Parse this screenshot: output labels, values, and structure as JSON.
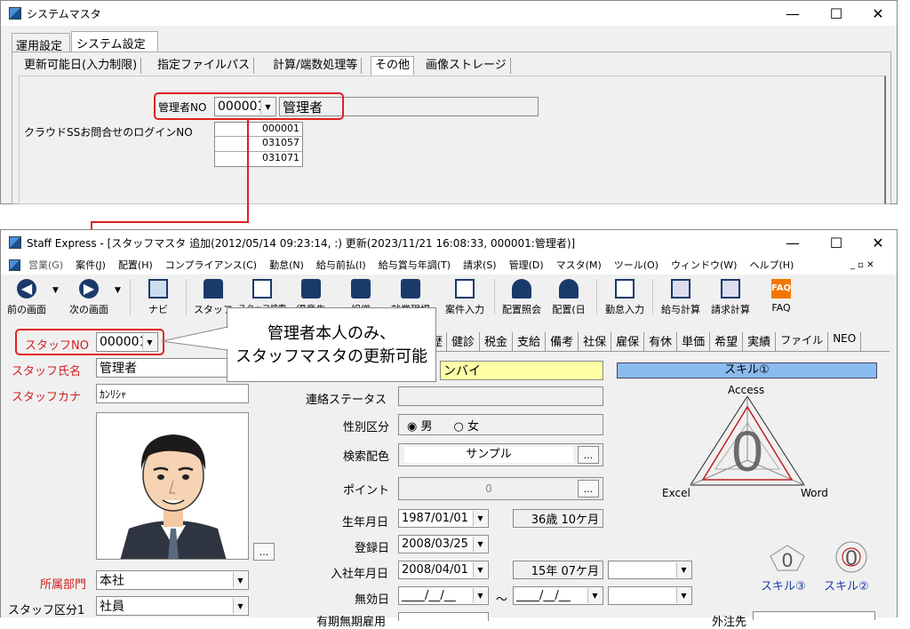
{
  "top_window": {
    "title": "システムマスタ",
    "tabs": [
      "運用設定",
      "システム設定"
    ],
    "subtabs": [
      "更新可能日(入力制限)",
      "指定ファイルパス",
      "計算/端数処理等",
      "その他",
      "画像ストレージ"
    ],
    "admin_label": "管理者NO",
    "admin_no": "000001",
    "admin_name": "管理者",
    "cloud_label": "クラウドSSお問合せのログインNO",
    "cloud_nos": [
      "000001",
      "031057",
      "031071"
    ]
  },
  "main_window": {
    "title": "Staff Express - [スタッフマスタ 追加(2012/05/14 09:23:14, :) 更新(2023/11/21 16:08:33, 000001:管理者)]",
    "menu": [
      "営業(G)",
      "案件(J)",
      "配置(H)",
      "コンプライアンス(C)",
      "勤怠(N)",
      "給与前払(I)",
      "給与賞与年調(T)",
      "請求(S)",
      "管理(D)",
      "マスタ(M)",
      "ツール(O)",
      "ウィンドウ(W)",
      "ヘルプ(H)"
    ],
    "toolbar": [
      "前の画面",
      "次の画面",
      "ナビ",
      "スタッフ",
      "スタッフ検索",
      "得意先",
      "組織",
      "就業現場",
      "案件入力",
      "配置照会",
      "配置(日",
      "勤怠入力",
      "給与計算",
      "請求計算",
      "FAQ"
    ],
    "tabs": [
      "歴",
      "健診",
      "税金",
      "支給",
      "備考",
      "社保",
      "雇保",
      "有休",
      "単価",
      "希望",
      "実績",
      "ファイル",
      "NEO"
    ]
  },
  "callout": {
    "line1": "管理者本人のみ、",
    "line2": "スタッフマスタの更新可能"
  },
  "form": {
    "staff_no_label": "スタッフNO",
    "staff_no": "000001",
    "name_label": "スタッフ氏名",
    "name": "管理者",
    "kana_label": "スタッフカナ",
    "kana": "ｶﾝﾘｼｬ",
    "dept_label": "所属部門",
    "dept": "本社",
    "type_label": "スタッフ区分1",
    "type": "社員",
    "photo_btn": "...",
    "yellow_value": "ンバイ",
    "contact_label": "連絡ステータス",
    "gender_label": "性別区分",
    "gender_male": "男",
    "gender_female": "女",
    "color_label": "検索配色",
    "color_value": "サンプル",
    "point_label": "ポイント",
    "point_value": "0",
    "birth_label": "生年月日",
    "birth": "1987/01/01",
    "age": "36歳 10ケ月",
    "reg_label": "登録日",
    "reg": "2008/03/25",
    "join_label": "入社年月日",
    "join": "2008/04/01",
    "tenure": "15年 07ケ月",
    "invalid_label": "無効日",
    "invalid_from": "____/__/__",
    "tilde": "～",
    "invalid_to": "____/__/__",
    "bottom_label": "有期無期雇用",
    "bottom_right_label": "外注先",
    "ellipsis": "..."
  },
  "skills": {
    "title": "スキル①",
    "access": "Access",
    "excel": "Excel",
    "word": "Word",
    "score": "0",
    "skill3": "スキル③",
    "skill2": "スキル②",
    "mini_score": "0"
  }
}
